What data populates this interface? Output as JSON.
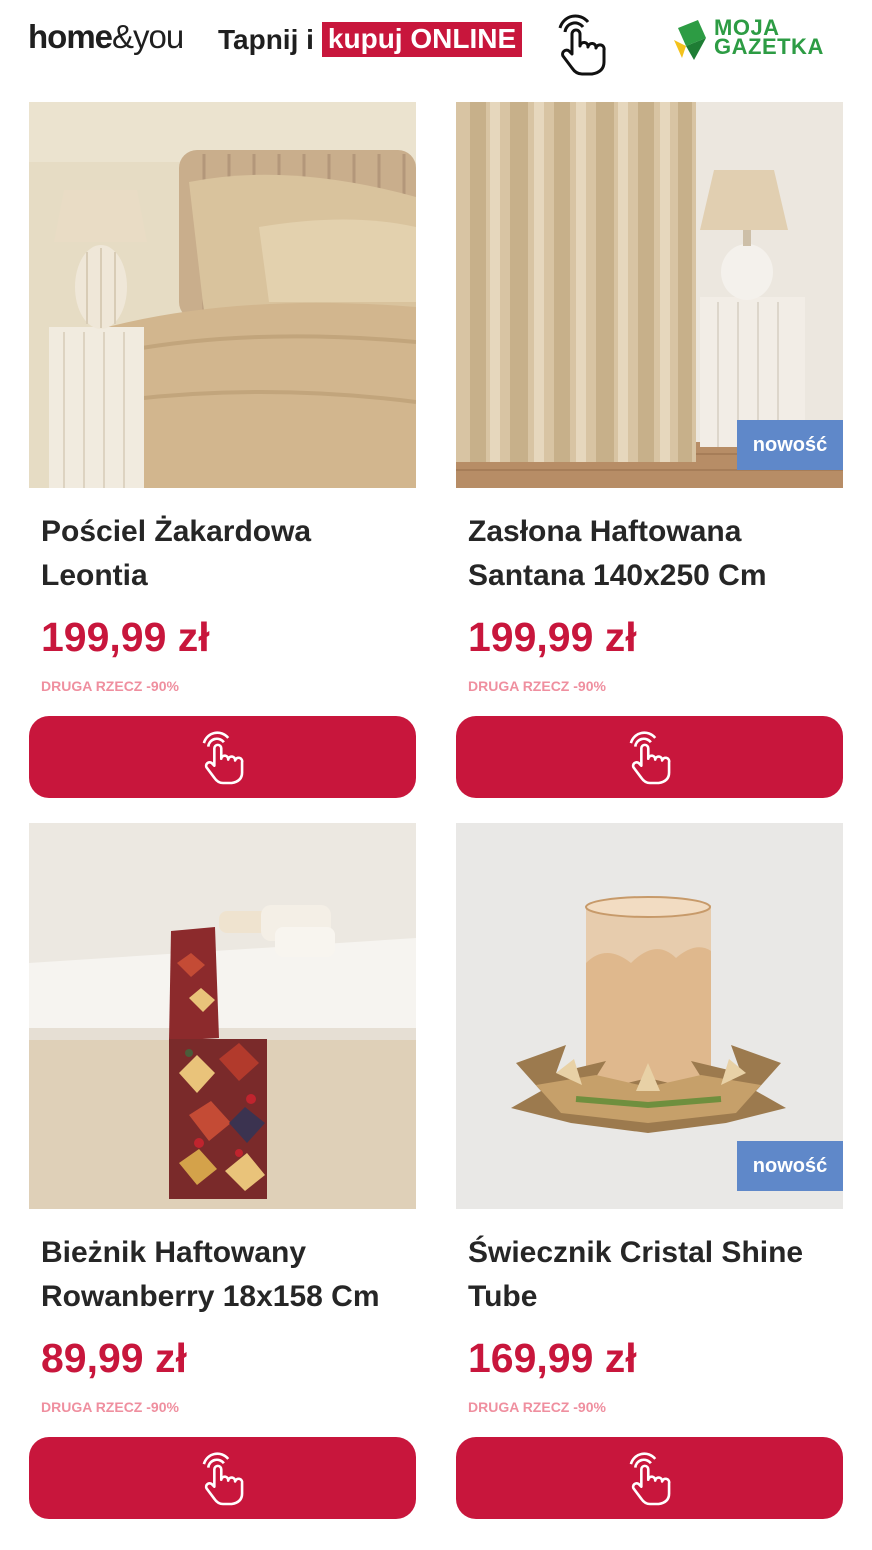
{
  "header": {
    "brand_bold": "home",
    "brand_light": "&you",
    "tagline_prefix": "Tapnij i",
    "tagline_highlight": "kupuj ONLINE",
    "partner_line1": "MOJA",
    "partner_line2": "GAZETKA"
  },
  "colors": {
    "accent": "#c8163c",
    "badge": "#5f88c9",
    "promo": "#ef8f9f",
    "partner_green": "#2d9c44"
  },
  "products": [
    {
      "title": "Pościel Żakardowa Leontia",
      "price": "199,99 zł",
      "promo": "DRUGA RZECZ -90%",
      "badge": "",
      "image": "beige-jacquard-bedding-photo",
      "button_icon": "tap-hand-icon"
    },
    {
      "title": "Zasłona Haftowana Santana 140x250 Cm",
      "price": "199,99 zł",
      "promo": "DRUGA RZECZ -90%",
      "badge": "nowość",
      "image": "embroidered-curtain-photo",
      "button_icon": "tap-hand-icon"
    },
    {
      "title": "Bieżnik Haftowany Rowanberry 18x158 Cm",
      "price": "89,99 zł",
      "promo": "DRUGA RZECZ -90%",
      "badge": "",
      "image": "leaf-table-runner-photo",
      "button_icon": "tap-hand-icon"
    },
    {
      "title": "Świecznik Cristal Shine Tube",
      "price": "169,99 zł",
      "promo": "DRUGA RZECZ -90%",
      "badge": "nowość",
      "image": "crystal-candle-holder-photo",
      "button_icon": "tap-hand-icon"
    }
  ]
}
